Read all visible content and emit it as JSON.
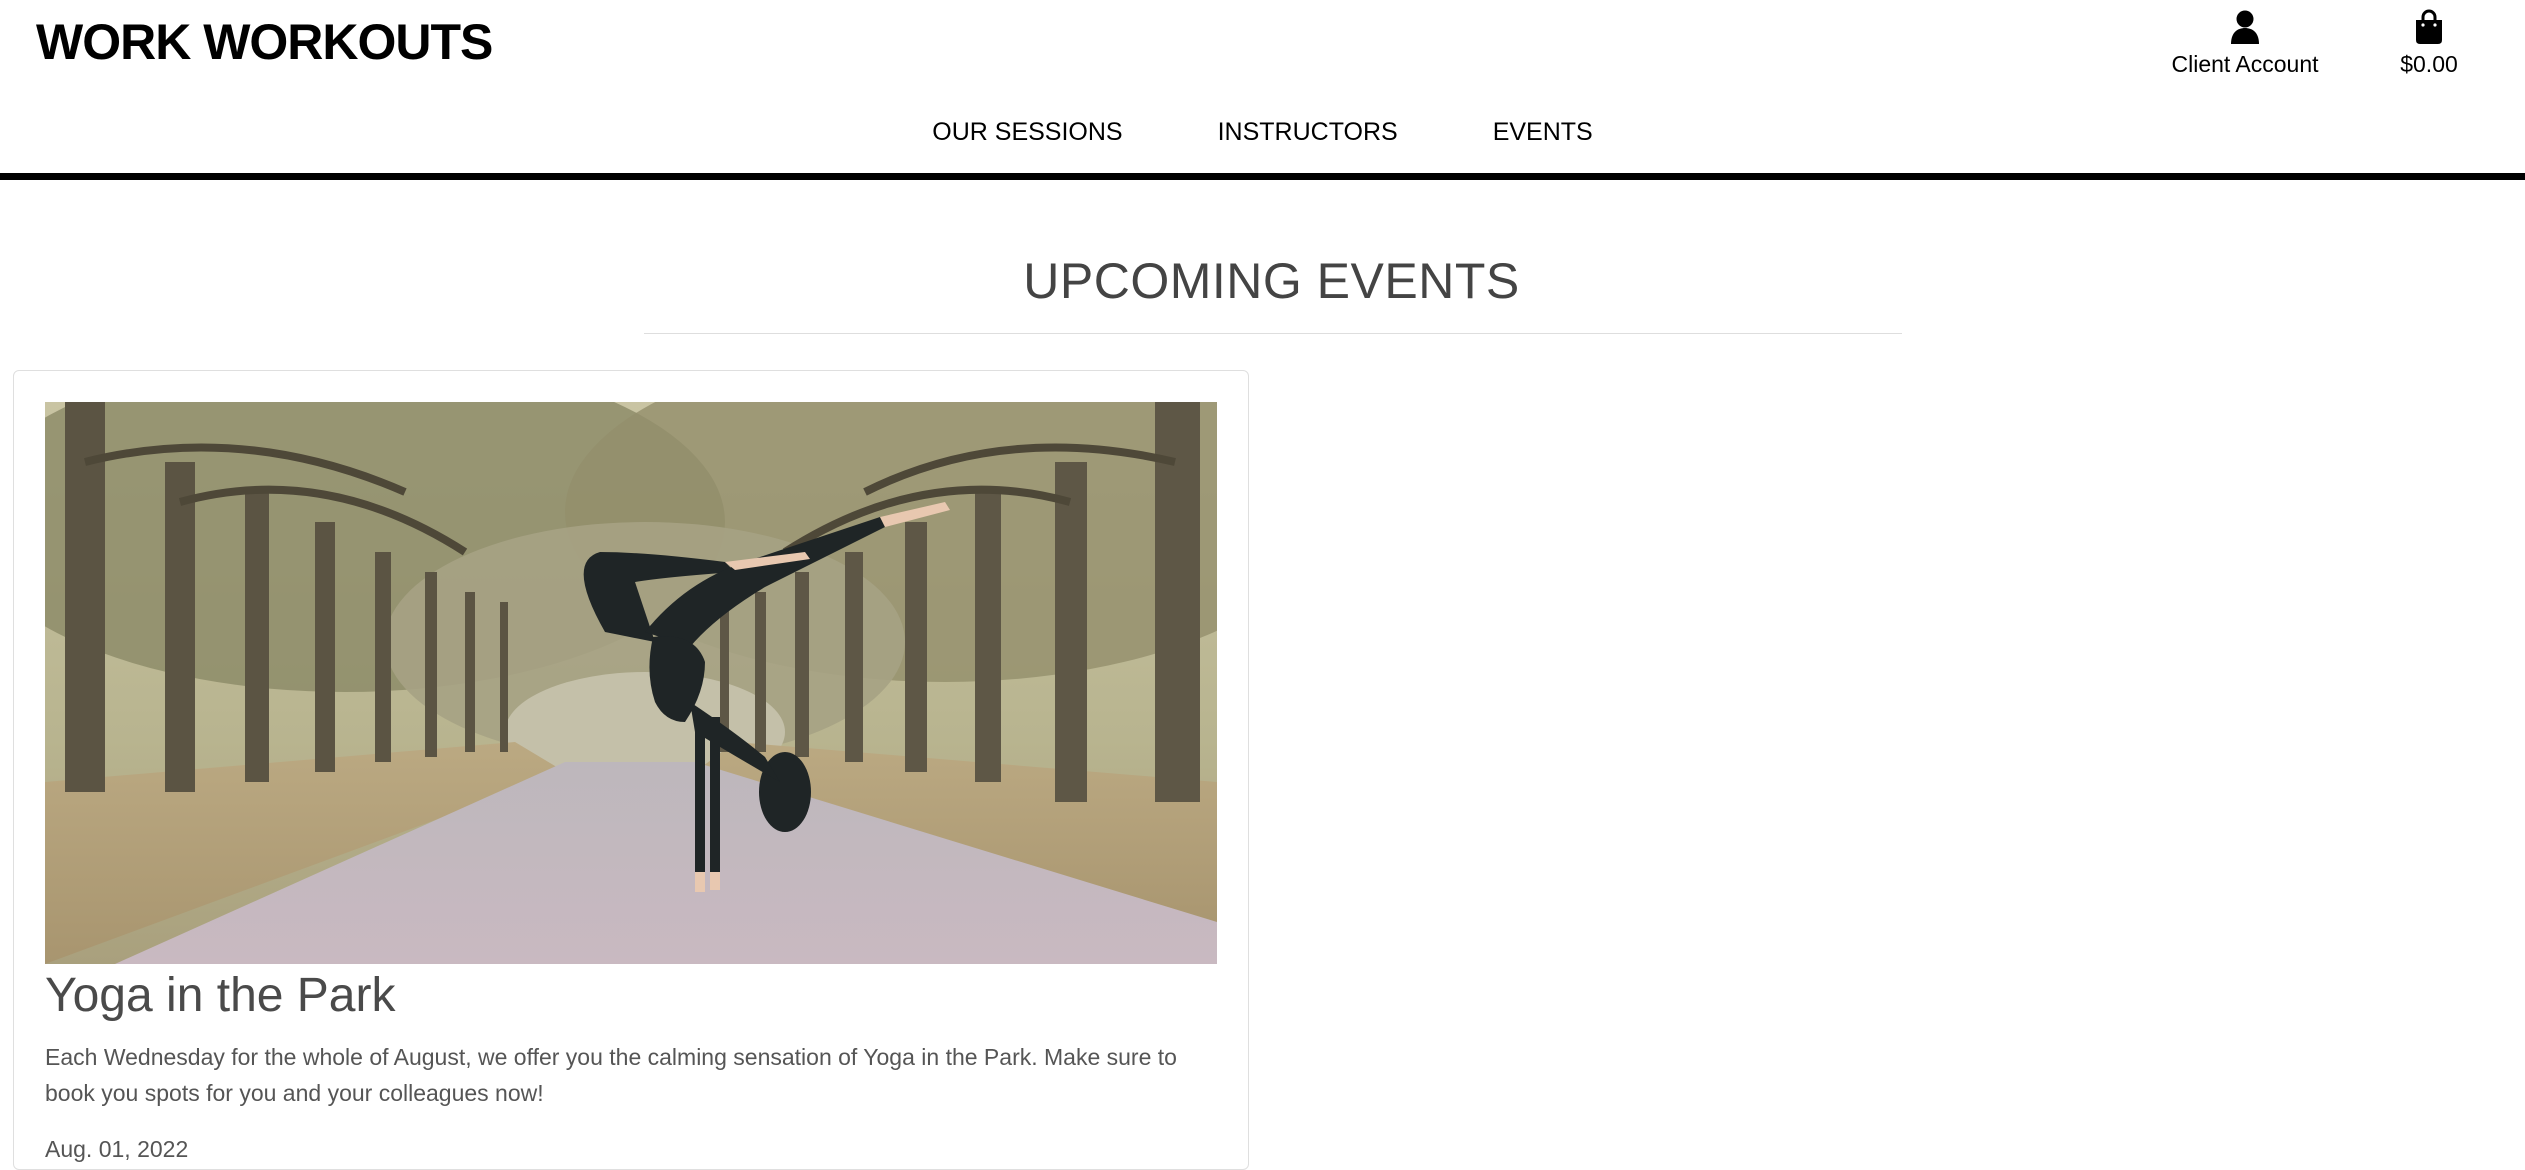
{
  "header": {
    "brand": "WORK WORKOUTS",
    "account_label": "Client Account",
    "bag_total": "$0.00",
    "account_icon": "user-icon",
    "bag_icon": "shopping-bag-icon"
  },
  "nav": {
    "items": [
      {
        "label": "OUR SESSIONS"
      },
      {
        "label": "INSTRUCTORS"
      },
      {
        "label": "EVENTS"
      }
    ]
  },
  "page": {
    "title": "UPCOMING EVENTS"
  },
  "events": [
    {
      "title": "Yoga in the Park",
      "description": "Each Wednesday for the whole of August, we offer you the calming sensation of Yoga in the Park. Make sure to book you spots for you and your colleagues now!",
      "date": "Aug. 01, 2022",
      "image": "yoga-handstand-in-park-photo"
    }
  ],
  "colors": {
    "text": "#000000",
    "muted": "#555555",
    "heading": "#444444",
    "rule": "#dedede",
    "header_border": "#000000"
  }
}
